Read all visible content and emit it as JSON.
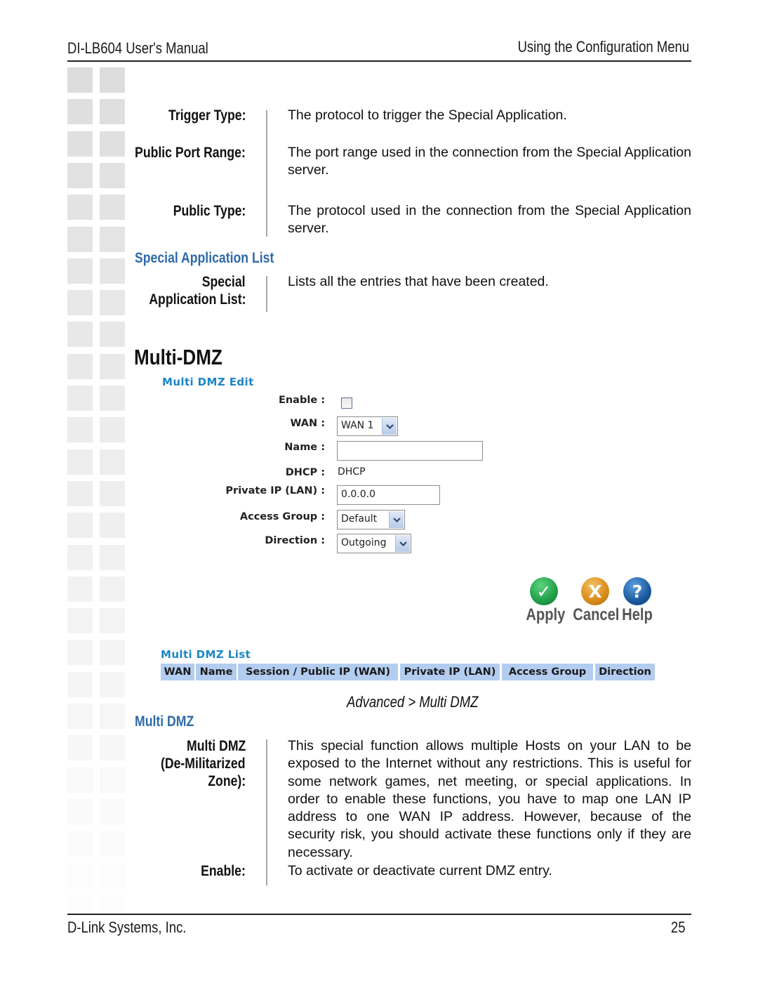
{
  "header": {
    "left": "DI-LB604 User's Manual",
    "right": "Using the Configuration Menu"
  },
  "footer": {
    "company": "D-Link Systems, Inc.",
    "page_number": "25"
  },
  "special_app_fields": [
    {
      "term": "Trigger Type:",
      "desc": "The protocol to trigger the Special Application."
    },
    {
      "term": "Public Port Range:",
      "desc": "The port range used in the connection from the Special Application server."
    },
    {
      "term": "Public Type:",
      "desc": "The protocol used in the connection from the Special Application server."
    }
  ],
  "special_app_list": {
    "heading": "Special Application List",
    "term_line1": "Special",
    "term_line2": "Application List:",
    "desc": "Lists all the entries that have been created."
  },
  "multi_dmz": {
    "title": "Multi-DMZ",
    "edit_panel": {
      "title": "Multi DMZ Edit",
      "enable_label": "Enable :",
      "enable_checked": false,
      "wan_label": "WAN :",
      "wan_value": "WAN 1",
      "name_label": "Name :",
      "name_value": "",
      "dhcp_label": "DHCP :",
      "dhcp_value": "DHCP",
      "private_ip_label": "Private IP (LAN) :",
      "private_ip_value": "0.0.0.0",
      "access_group_label": "Access Group :",
      "access_group_value": "Default",
      "direction_label": "Direction :",
      "direction_value": "Outgoing"
    },
    "actions": {
      "apply": "Apply",
      "cancel": "Cancel",
      "help": "Help",
      "apply_glyph": "✓",
      "cancel_glyph": "X",
      "help_glyph": "?",
      "colors": {
        "apply": "#1f9e48",
        "cancel": "#d98a1a",
        "help": "#1b5a9e"
      }
    },
    "list_panel": {
      "title": "Multi DMZ List",
      "columns": [
        "WAN",
        "Name",
        "Session / Public IP (WAN)",
        "Private IP (LAN)",
        "Access Group",
        "Direction"
      ]
    },
    "caption": "Advanced > Multi DMZ",
    "section_heading": "Multi DMZ",
    "definitions": {
      "dmz_term_line1": "Multi DMZ",
      "dmz_term_line2": "(De-Militarized",
      "dmz_term_line3": "Zone):",
      "dmz_desc": "This special function allows multiple Hosts on your LAN to be exposed to the Internet without any restrictions. This is useful for some network games, net meeting, or special applications. In order to enable these functions, you have to map one LAN IP address to one WAN IP address.  However, because of the security risk, you should activate these functions only if they are necessary.",
      "enable_term": "Enable:",
      "enable_desc": "To activate or deactivate current DMZ entry."
    }
  },
  "colors": {
    "section_heading": "#2e6aa8",
    "ui_title": "#1d86c4",
    "table_header": "#b3cdf0"
  }
}
